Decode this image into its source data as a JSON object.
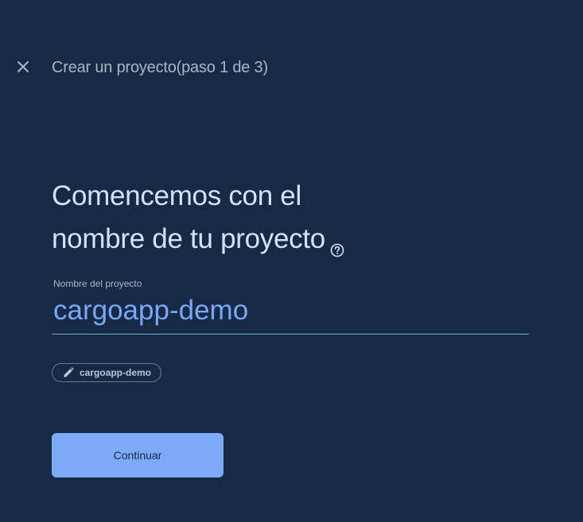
{
  "header": {
    "close_icon": "close-icon",
    "title": "Crear un proyecto(paso 1 de 3)"
  },
  "main": {
    "heading_line1": "Comencemos con el",
    "heading_line2": "nombre de tu proyecto",
    "help_icon": "help-circle-icon",
    "project_name_field": {
      "label": "Nombre del proyecto",
      "value": "cargoapp-demo"
    },
    "project_id_chip": {
      "icon": "pencil-icon",
      "label": "cargoapp-demo"
    },
    "continue_button": {
      "label": "Continuar"
    }
  },
  "colors": {
    "background": "#172a45",
    "heading": "#cfe3ff",
    "accent": "#7aa6f6",
    "button": "#7daaf7",
    "muted_text": "#a9b6c8"
  }
}
